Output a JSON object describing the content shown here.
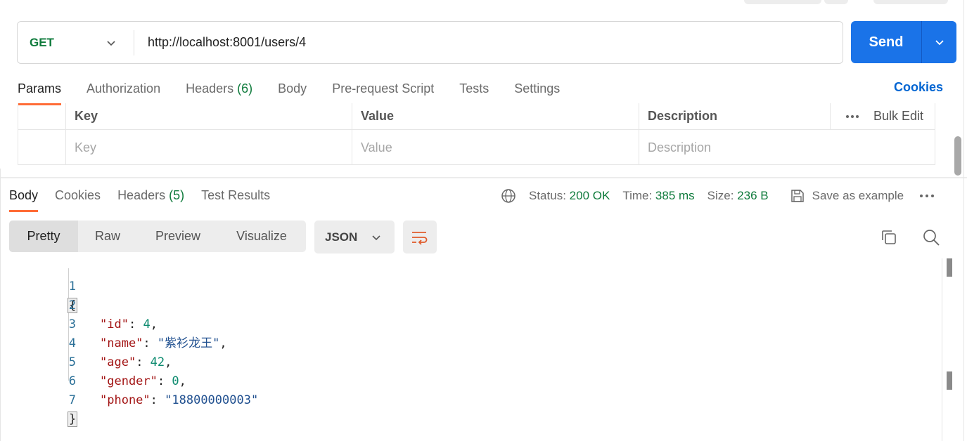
{
  "request": {
    "method": "GET",
    "url": "http://localhost:8001/users/4",
    "send_label": "Send"
  },
  "request_tabs": {
    "params": "Params",
    "authorization": "Authorization",
    "headers_label": "Headers",
    "headers_count": "(6)",
    "body": "Body",
    "pre_request": "Pre-request Script",
    "tests": "Tests",
    "settings": "Settings",
    "cookies": "Cookies"
  },
  "params_table": {
    "headers": {
      "key": "Key",
      "value": "Value",
      "description": "Description",
      "bulk_edit": "Bulk Edit"
    },
    "placeholders": {
      "key": "Key",
      "value": "Value",
      "description": "Description"
    }
  },
  "response_tabs": {
    "body": "Body",
    "cookies": "Cookies",
    "headers_label": "Headers",
    "headers_count": "(5)",
    "test_results": "Test Results"
  },
  "response_meta": {
    "status_label": "Status:",
    "status_value": "200 OK",
    "time_label": "Time:",
    "time_value": "385 ms",
    "size_label": "Size:",
    "size_value": "236 B",
    "save_example": "Save as example"
  },
  "response_view": {
    "modes": [
      "Pretty",
      "Raw",
      "Preview",
      "Visualize"
    ],
    "active_mode": "Pretty",
    "format": "JSON"
  },
  "response_body": {
    "line_numbers": [
      "1",
      "2",
      "3",
      "4",
      "5",
      "6",
      "7"
    ],
    "open_brace": "{",
    "close_brace": "}",
    "fields": [
      {
        "key": "\"id\"",
        "value": "4",
        "type": "number"
      },
      {
        "key": "\"name\"",
        "value": "\"紫衫龙王\"",
        "type": "string"
      },
      {
        "key": "\"age\"",
        "value": "42",
        "type": "number"
      },
      {
        "key": "\"gender\"",
        "value": "0",
        "type": "number"
      },
      {
        "key": "\"phone\"",
        "value": "\"18800000003\"",
        "type": "string"
      }
    ]
  },
  "icons": {
    "method_dropdown": "chevron-down-icon",
    "send_dropdown": "chevron-down-icon",
    "bulk_more": "more-horizontal-icon",
    "globe": "globe-icon",
    "save": "save-icon",
    "more": "more-horizontal-icon",
    "wrap": "wrap-lines-icon",
    "copy": "copy-icon",
    "search": "search-icon"
  },
  "colors": {
    "accent": "#ff6c37",
    "primary": "#1a73e8",
    "success": "#0f7b3c",
    "link": "#0265d2"
  }
}
